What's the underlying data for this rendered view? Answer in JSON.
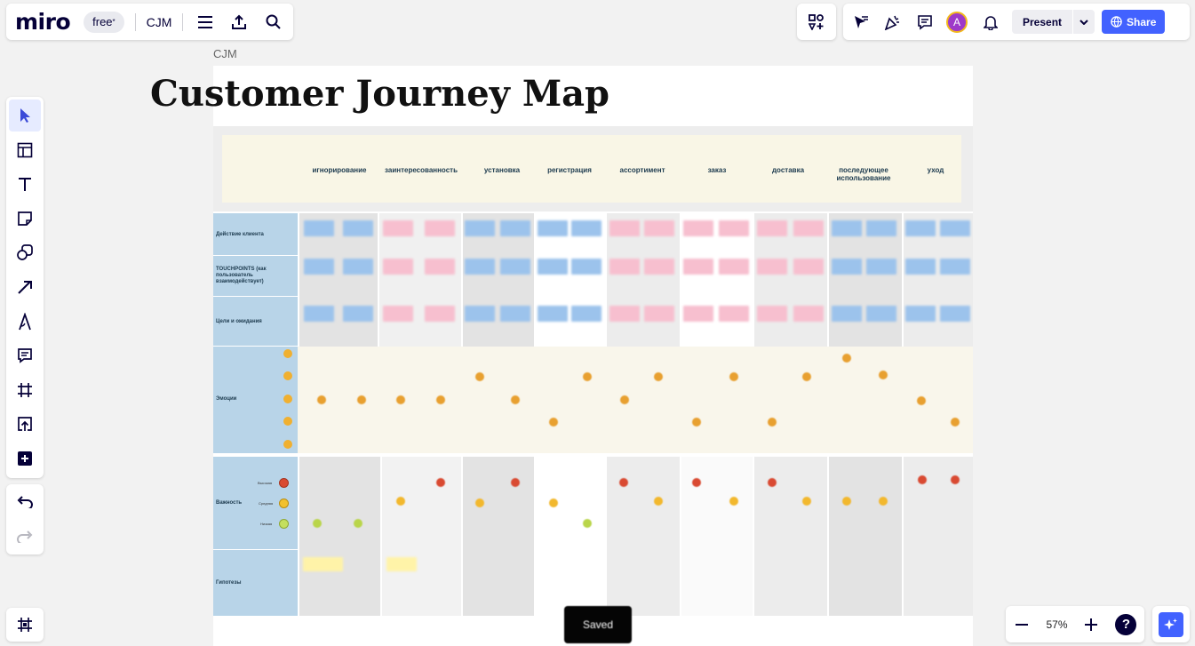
{
  "app": {
    "logo": "miro",
    "plan_badge": "free",
    "plan_mark": "*",
    "board_name": "CJM"
  },
  "toolbar_right": {
    "present_label": "Present",
    "share_label": "Share",
    "avatar_initial": "A"
  },
  "board": {
    "frame_label": "CJM",
    "title": "Customer Journey Map",
    "stages": [
      "игнорирование",
      "заинтересованность",
      "установка",
      "регистрация",
      "ассортимент",
      "заказ",
      "доставка",
      "последующее использование",
      "уход"
    ],
    "rows": {
      "actions": "Действие клиента",
      "touchpoints": "TOUCHPOINTS (как пользователь взаимодействует)",
      "goals": "Цели и ожидания",
      "emotions": "Эмоции",
      "importance": "Важность",
      "hypotheses": "Гипотезы"
    },
    "importance_legend": [
      "Высокая",
      "Средняя",
      "Низкая"
    ],
    "colors": {
      "blue_sticky": "#9cc3ec",
      "pink_sticky": "#f7bfcf",
      "orange_dot": "#e8a030",
      "red_dot": "#d94a32",
      "yellow_dot": "#f2c12e",
      "green_dot": "#b9d54a",
      "row_label_bg": "#b8d4e8"
    }
  },
  "status": {
    "saved": "Saved"
  },
  "zoom": {
    "level": "57%"
  }
}
